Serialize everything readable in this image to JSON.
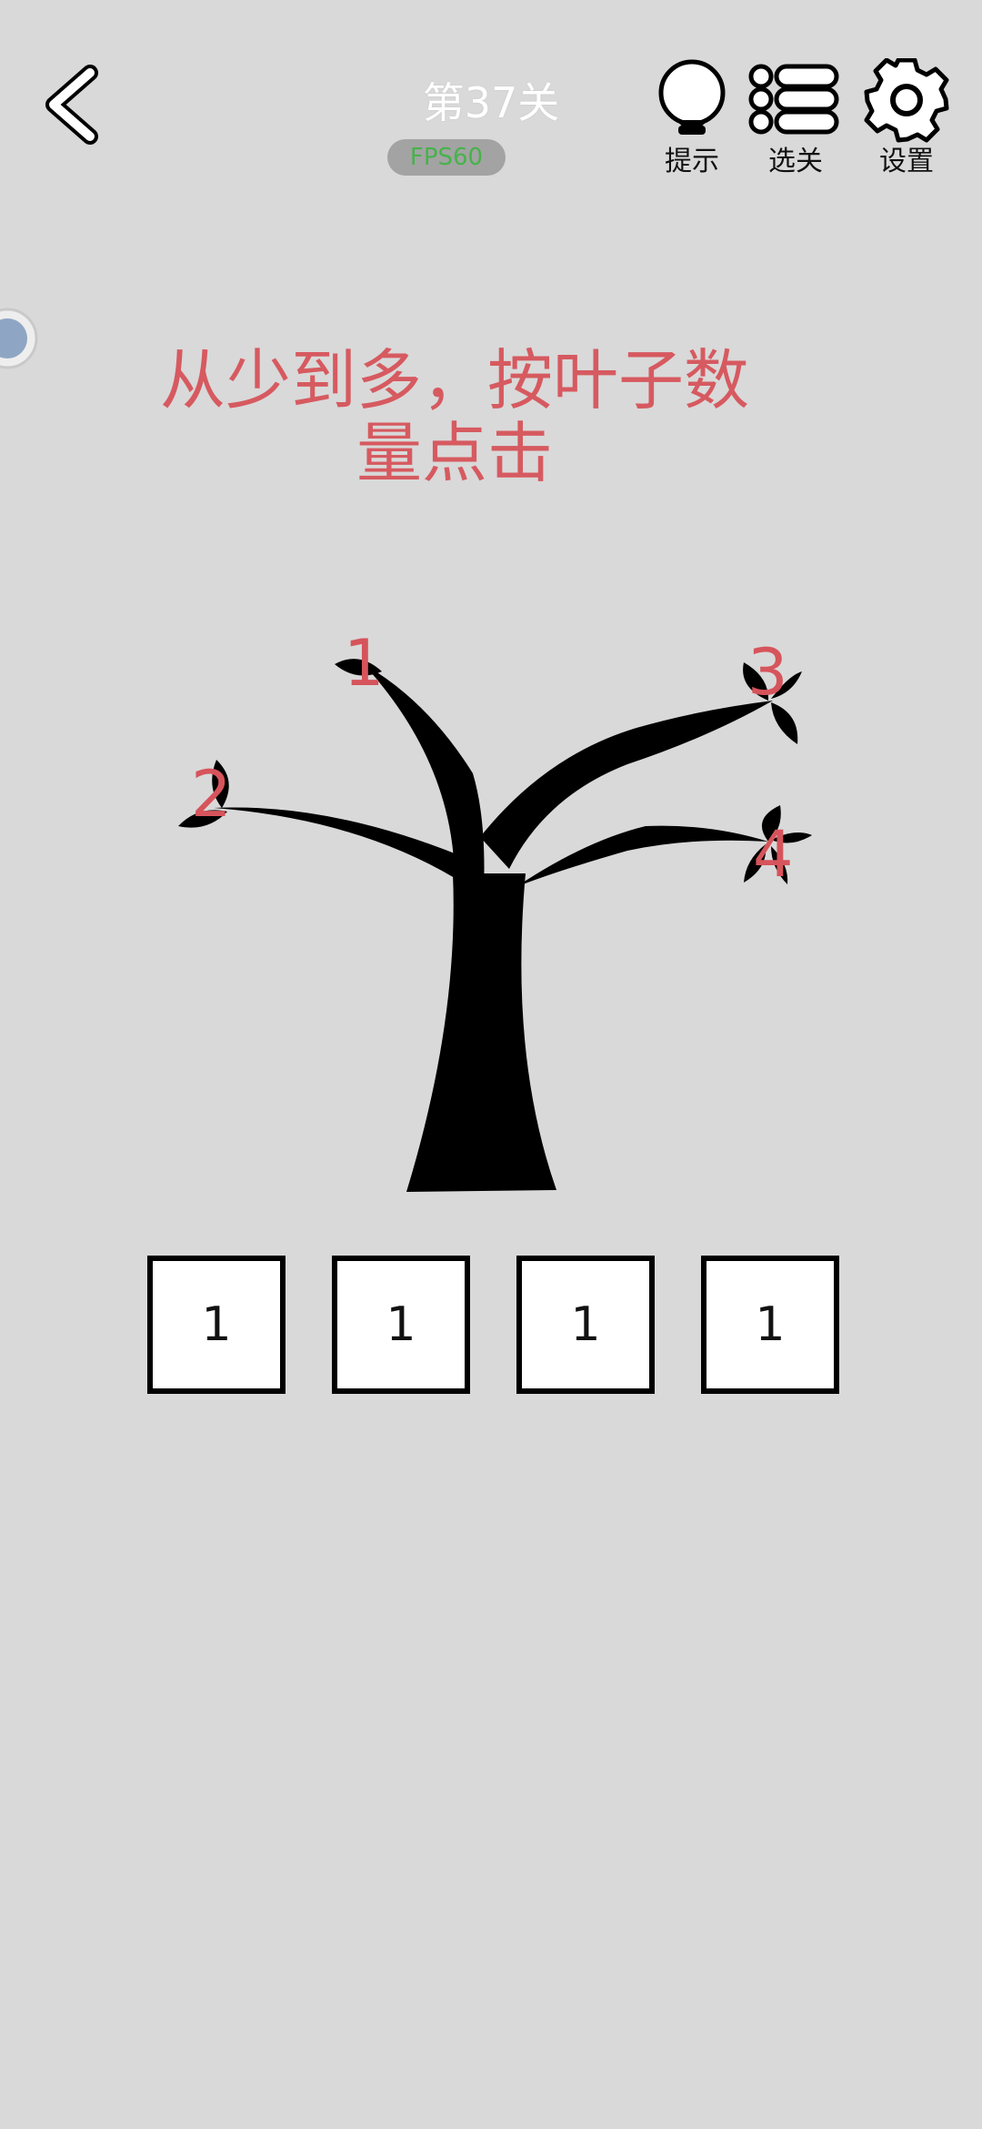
{
  "header": {
    "level_title": "第37关",
    "fps_label": "FPS60",
    "tools": [
      {
        "label": "提示",
        "icon": "lightbulb-icon"
      },
      {
        "label": "选关",
        "icon": "list-icon"
      },
      {
        "label": "设置",
        "icon": "gear-icon"
      }
    ]
  },
  "instruction": {
    "line1": "从少到多，按叶子数",
    "line2": "量点击"
  },
  "branches": [
    {
      "number": "1"
    },
    {
      "number": "2"
    },
    {
      "number": "3"
    },
    {
      "number": "4"
    }
  ],
  "answer_boxes": [
    "1",
    "1",
    "1",
    "1"
  ],
  "colors": {
    "background": "#d9d9d9",
    "accent_red": "#d6545b",
    "fps_green": "#46b34a"
  }
}
